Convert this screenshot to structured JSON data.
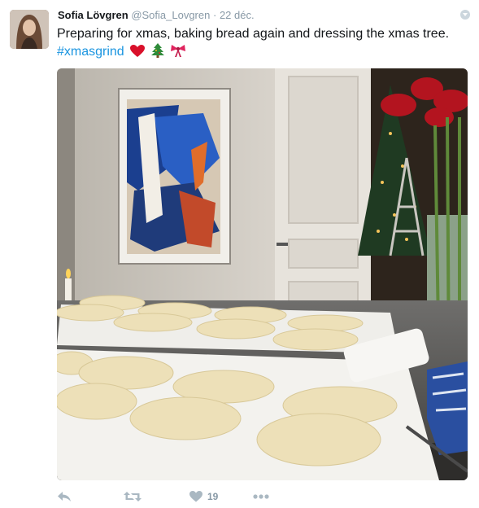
{
  "tweet": {
    "display_name": "Sofia Lövgren",
    "handle": "@Sofia_Lovgren",
    "separator": "·",
    "date": "22 déc.",
    "text": "Preparing for xmas, baking bread again and dressing the xmas tree.",
    "hashtag": "#xmasgrind",
    "emojis": [
      "red-heart",
      "christmas-tree",
      "ribbon-bow"
    ]
  },
  "media": {
    "description_icon": "photo"
  },
  "actions": {
    "reply_icon": "reply-arrow",
    "retweet_icon": "retweet-arrows",
    "like_icon": "heart",
    "like_count": "19",
    "more_icon": "ellipsis"
  },
  "colors": {
    "hashtag": "#1b95e0",
    "muted": "#8899a6",
    "action_icons": "#aab8c2"
  }
}
